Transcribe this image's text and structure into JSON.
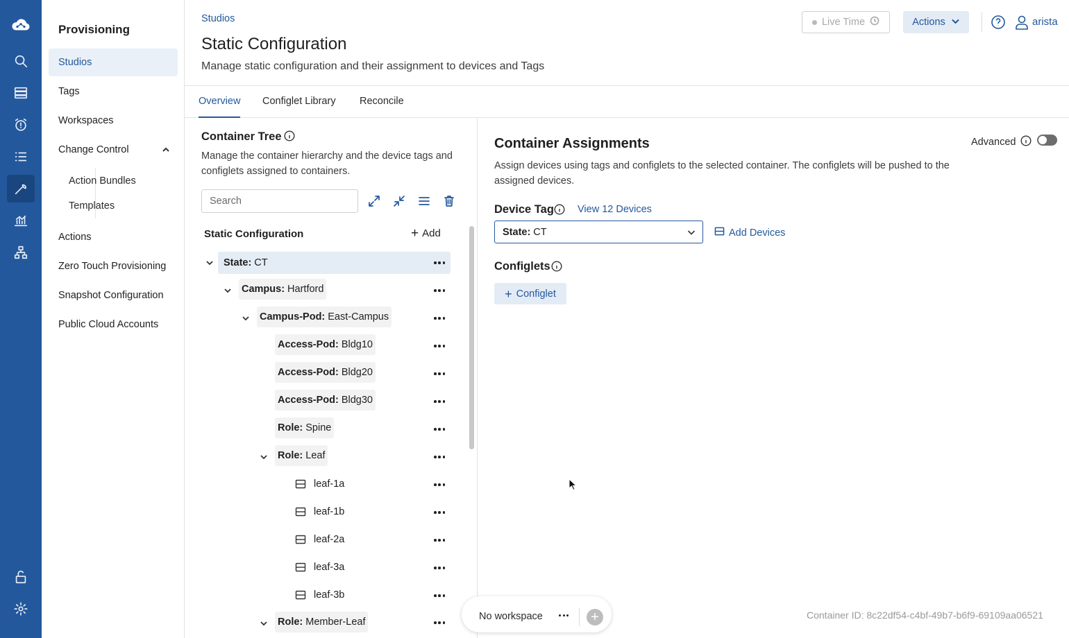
{
  "rail": {
    "items": [
      {
        "name": "cloud-logo-icon"
      },
      {
        "name": "search-icon"
      },
      {
        "name": "devices-icon"
      },
      {
        "name": "events-alarm-icon"
      },
      {
        "name": "tasks-list-icon"
      },
      {
        "name": "provisioning-wrench-icon"
      },
      {
        "name": "dashboards-chart-icon"
      },
      {
        "name": "topology-icon"
      },
      {
        "name": "unlock-icon"
      },
      {
        "name": "settings-gear-icon"
      }
    ]
  },
  "sidebar": {
    "title": "Provisioning",
    "items": [
      {
        "label": "Studios",
        "active": true
      },
      {
        "label": "Tags"
      },
      {
        "label": "Workspaces"
      },
      {
        "label": "Change Control"
      },
      {
        "label": "Action Bundles"
      },
      {
        "label": "Templates"
      },
      {
        "label": "Actions"
      },
      {
        "label": "Zero Touch Provisioning"
      },
      {
        "label": "Snapshot Configuration"
      },
      {
        "label": "Public Cloud Accounts"
      }
    ]
  },
  "header": {
    "breadcrumb": "Studios",
    "title": "Static Configuration",
    "subtitle": "Manage static configuration and their assignment to devices and Tags",
    "live_time_label": "Live Time",
    "actions_label": "Actions",
    "user": "arista"
  },
  "tabs": [
    {
      "label": "Overview",
      "active": true
    },
    {
      "label": "Configlet Library"
    },
    {
      "label": "Reconcile"
    }
  ],
  "tree": {
    "title": "Container Tree",
    "description": "Manage the container hierarchy and the device tags and configlets assigned to containers.",
    "search_placeholder": "Search",
    "root_label": "Static Configuration",
    "add_label": "Add",
    "nodes": [
      {
        "key": "State:",
        "value": "CT"
      },
      {
        "key": "Campus:",
        "value": "Hartford"
      },
      {
        "key": "Campus-Pod:",
        "value": "East-Campus"
      },
      {
        "key": "Access-Pod:",
        "value": "Bldg10"
      },
      {
        "key": "Access-Pod:",
        "value": "Bldg20"
      },
      {
        "key": "Access-Pod:",
        "value": "Bldg30"
      },
      {
        "key": "Role:",
        "value": "Spine"
      },
      {
        "key": "Role:",
        "value": "Leaf"
      },
      {
        "device": "leaf-1a"
      },
      {
        "device": "leaf-1b"
      },
      {
        "device": "leaf-2a"
      },
      {
        "device": "leaf-3a"
      },
      {
        "device": "leaf-3b"
      },
      {
        "key": "Role:",
        "value": "Member-Leaf"
      }
    ]
  },
  "assignments": {
    "title": "Container Assignments",
    "advanced_label": "Advanced",
    "advanced_on": false,
    "description": "Assign devices using tags and configlets to the selected container. The configlets will be pushed to the assigned devices.",
    "device_tag_label": "Device Tag",
    "view_devices_link": "View 12 Devices",
    "device_tag_key": "State:",
    "device_tag_value": "CT",
    "add_devices_label": "Add Devices",
    "configlets_label": "Configlets",
    "configlet_button": "Configlet",
    "container_id": "Container ID: 8c22df54-c4bf-49b7-b6f9-69109aa06521"
  },
  "workspace": {
    "label": "No workspace"
  },
  "colors": {
    "rail": "#23589c",
    "accent": "#23589c",
    "selected_bg": "#e4ecf6"
  }
}
